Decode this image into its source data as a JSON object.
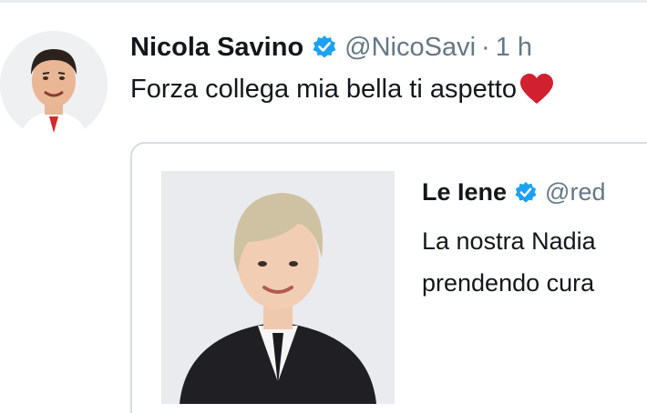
{
  "tweet": {
    "author_name": "Nicola Savino",
    "author_handle": "@NicoSavi",
    "separator": "·",
    "timestamp": "1 h",
    "text": "Forza collega mia bella ti aspetto",
    "emoji_icon": "red-heart-icon",
    "verified_icon": "verified-badge-icon"
  },
  "quoted_tweet": {
    "author_name": "Le Iene",
    "author_handle": "@red",
    "text_line_1": "La nostra Nadia",
    "text_line_2": "prendendo cura",
    "verified_icon": "verified-badge-icon"
  },
  "colors": {
    "text_primary": "#14171a",
    "text_secondary": "#657786",
    "verified_blue": "#1da1f2",
    "heart_red": "#d1202f",
    "card_border": "#d6dde2"
  }
}
